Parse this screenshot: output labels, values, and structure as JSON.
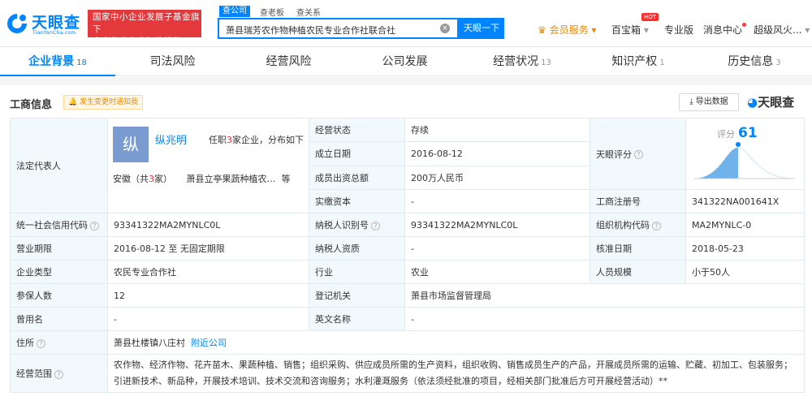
{
  "brand": {
    "name": "天眼查",
    "sub": "TianYanCha.com",
    "banner_line1": "国家中小企业发展子基金旗下",
    "banner_line2": "官方备案企业征信机构",
    "color": "#0084ff"
  },
  "search": {
    "tabs": [
      "查公司",
      "查老板",
      "查关系"
    ],
    "value": "萧县瑞芳农作物种植农民专业合作社联合社",
    "button": "天眼一下"
  },
  "nav": {
    "vip": "会员服务",
    "baibao": "百宝箱",
    "hot": "HOT",
    "pro": "专业版",
    "msg": "消息中心",
    "user": "超级风火..."
  },
  "tabs": [
    {
      "label": "企业背景",
      "count": "18"
    },
    {
      "label": "司法风险",
      "count": ""
    },
    {
      "label": "经营风险",
      "count": ""
    },
    {
      "label": "公司发展",
      "count": ""
    },
    {
      "label": "经营状况",
      "count": "13"
    },
    {
      "label": "知识产权",
      "count": "1"
    },
    {
      "label": "历史信息",
      "count": "3"
    }
  ],
  "section": {
    "title": "工商信息",
    "notify": "发生变更时通知我",
    "export": "导出数据",
    "logo": "天眼查"
  },
  "legal": {
    "label": "法定代表人",
    "avatar": "纵",
    "name": "纵兆明",
    "posts_pre": "任职",
    "posts_num": "3",
    "posts_post": "家企业，分布如下",
    "region_pre": "安徽（共",
    "region_num": "3",
    "region_post": "家）",
    "company": "萧县立亭果蔬种植农…",
    "more": "等"
  },
  "basic": {
    "status_label": "经营状态",
    "status": "存续",
    "estab_label": "成立日期",
    "estab": "2016-08-12",
    "capital_label": "成员出资总额",
    "capital": "200万人民币",
    "paid_label": "实缴资本",
    "paid": "-",
    "score_label": "天眼评分",
    "score_word": "评分",
    "score": "61",
    "reg_label": "工商注册号",
    "reg": "341322NA001641X"
  },
  "rows": [
    {
      "l1": "统一社会信用代码",
      "v1": "93341322MA2MYNLC0L",
      "l2": "纳税人识别号",
      "v2": "93341322MA2MYNLC0L",
      "l3": "组织机构代码",
      "v3": "MA2MYNLC-0"
    },
    {
      "l1": "营业期限",
      "v1": "2016-08-12 至 无固定期限",
      "l2": "纳税人资质",
      "v2": "-",
      "l3": "核准日期",
      "v3": "2018-05-23"
    },
    {
      "l1": "企业类型",
      "v1": "农民专业合作社",
      "l2": "行业",
      "v2": "农业",
      "l3": "人员规模",
      "v3": "小于50人"
    },
    {
      "l1": "参保人数",
      "v1": "12",
      "l2": "登记机关",
      "v2": "萧县市场监督管理局"
    },
    {
      "l1": "曾用名",
      "v1": "-",
      "l2": "英文名称",
      "v2": "-"
    }
  ],
  "address": {
    "label": "住所",
    "value": "萧县杜楼镇八庄村",
    "link": "附近公司"
  },
  "scope": {
    "label": "经营范围",
    "value": "农作物、经济作物、花卉苗木、果蔬种植、销售；组织采购、供应成员所需的生产资料，组织收购、销售成员生产的产品，开展成员所需的运输、贮藏、初加工、包装服务；引进新技术、新品种，开展技术培训、技术交流和咨询服务；水利灌溉服务（依法须经批准的项目，经相关部门批准后方可开展经营活动）**"
  }
}
